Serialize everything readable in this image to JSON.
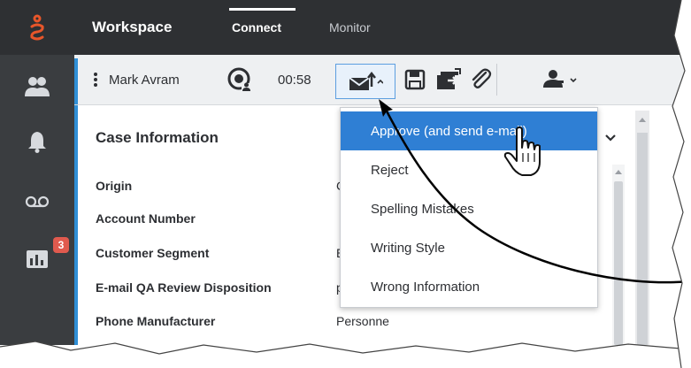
{
  "app": {
    "title": "Workspace",
    "tabs": [
      {
        "label": "Connect",
        "active": true
      },
      {
        "label": "Monitor",
        "active": false
      }
    ]
  },
  "left_nav": {
    "items": [
      {
        "icon": "users-icon"
      },
      {
        "icon": "bell-icon"
      },
      {
        "icon": "voicemail-icon"
      },
      {
        "icon": "reports-icon",
        "badge": "3"
      }
    ]
  },
  "toolbar": {
    "agent_name": "Mark Avram",
    "timer": "00:58"
  },
  "case": {
    "section_title": "Case Information",
    "rows": [
      {
        "label": "Origin",
        "value": "C"
      },
      {
        "label": "Account Number",
        "value": ""
      },
      {
        "label": "Customer Segment",
        "value": "E"
      },
      {
        "label": "E-mail QA Review Disposition",
        "value": "p"
      },
      {
        "label": "Phone Manufacturer",
        "value": "Personne"
      }
    ]
  },
  "dropdown": {
    "items": [
      {
        "label": "Approve (and send e-mail)",
        "active": true
      },
      {
        "label": "Reject",
        "active": false
      },
      {
        "label": "Spelling Mistakes",
        "active": false
      },
      {
        "label": "Writing Style",
        "active": false
      },
      {
        "label": "Wrong Information",
        "active": false
      }
    ]
  },
  "colors": {
    "accent": "#2f7fd4",
    "nav_bg": "#3a3d40",
    "topbar_bg": "#2e3033",
    "logo": "#e8562a",
    "badge": "#e05a4e"
  }
}
